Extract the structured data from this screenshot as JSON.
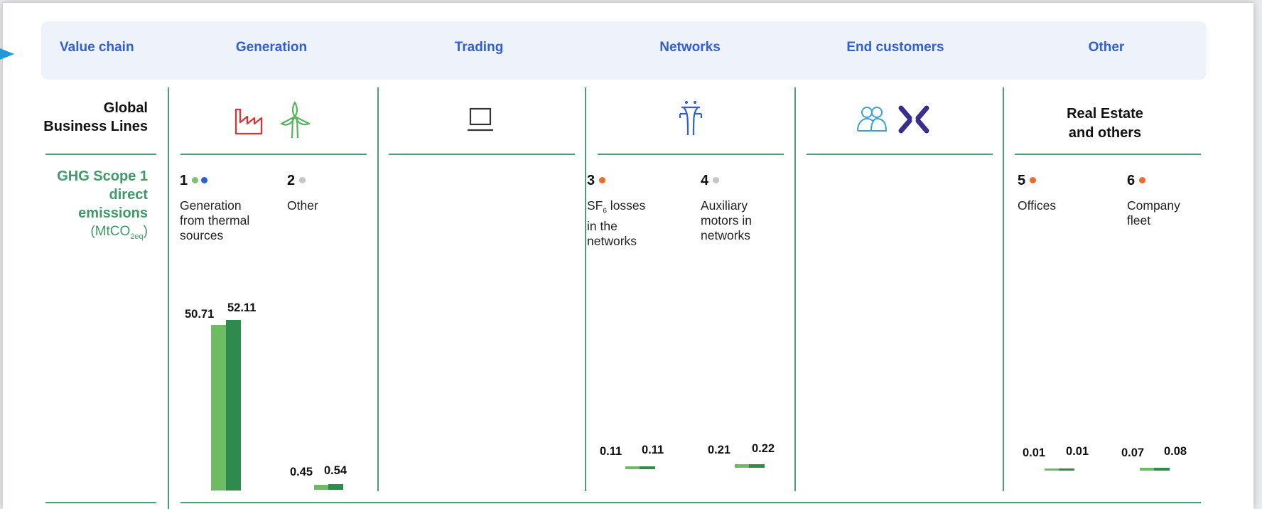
{
  "header": {
    "value_chain": "Value chain",
    "columns": [
      "Generation",
      "Trading",
      "Networks",
      "End customers",
      "Other"
    ]
  },
  "rows": {
    "global_line1": "Global",
    "global_line2": "Business Lines",
    "scope_line1": "GHG Scope 1",
    "scope_line2": "direct",
    "scope_line3": "emissions",
    "scope_unit_prefix": "(MtCO",
    "scope_unit_sub": "2eq",
    "scope_unit_suffix": ")"
  },
  "real_estate": {
    "line1": "Real Estate",
    "line2": "and others"
  },
  "colors": {
    "accent_blue": "#2f5fd0",
    "green_light": "#6cbd62",
    "green_dark": "#2f8a4e",
    "dot_orange": "#ef6a2c",
    "dot_grey": "#c6c6c6",
    "dot_blue": "#2a5fdc",
    "dot_green": "#7cc36b"
  },
  "icons": [
    "factory-icon",
    "wind-turbine-icon",
    "laptop-icon",
    "power-pylon-icon",
    "customers-icon",
    "brand-x-icon"
  ],
  "items": [
    {
      "num": "1",
      "dots": [
        "#7cc36b",
        "#2a5fdc"
      ],
      "l1": "Generation",
      "l2": "from thermal",
      "l3": "sources"
    },
    {
      "num": "2",
      "dots": [
        "#c6c6c6"
      ],
      "l1": "Other",
      "l2": "",
      "l3": ""
    },
    {
      "num": "3",
      "dots": [
        "#ef6a2c"
      ],
      "l1_main": "SF",
      "l1_sub": "6",
      "l1_rest": " losses",
      "l2": "in the",
      "l3": "networks"
    },
    {
      "num": "4",
      "dots": [
        "#c6c6c6"
      ],
      "l1": "Auxiliary",
      "l2": "motors in",
      "l3": "networks"
    },
    {
      "num": "5",
      "dots": [
        "#ef6a2c"
      ],
      "l1": "Offices",
      "l2": "",
      "l3": ""
    },
    {
      "num": "6",
      "dots": [
        "#ef6a2c"
      ],
      "l1": "Company",
      "l2": "fleet",
      "l3": ""
    }
  ],
  "chart_data": {
    "type": "bar",
    "categories": [
      "Generation from thermal sources",
      "Other",
      "SF6 losses in the networks",
      "Auxiliary motors in networks",
      "Offices",
      "Company fleet"
    ],
    "series": [
      {
        "values": [
          50.71,
          0.45,
          0.11,
          0.21,
          0.01,
          0.07
        ]
      },
      {
        "values": [
          52.11,
          0.54,
          0.11,
          0.22,
          0.01,
          0.08
        ]
      }
    ],
    "labels": [
      [
        "50.71",
        "52.11"
      ],
      [
        "0.45",
        "0.54"
      ],
      [
        "0.11",
        "0.11"
      ],
      [
        "0.21",
        "0.22"
      ],
      [
        "0.01",
        "0.01"
      ],
      [
        "0.07",
        "0.08"
      ]
    ]
  }
}
